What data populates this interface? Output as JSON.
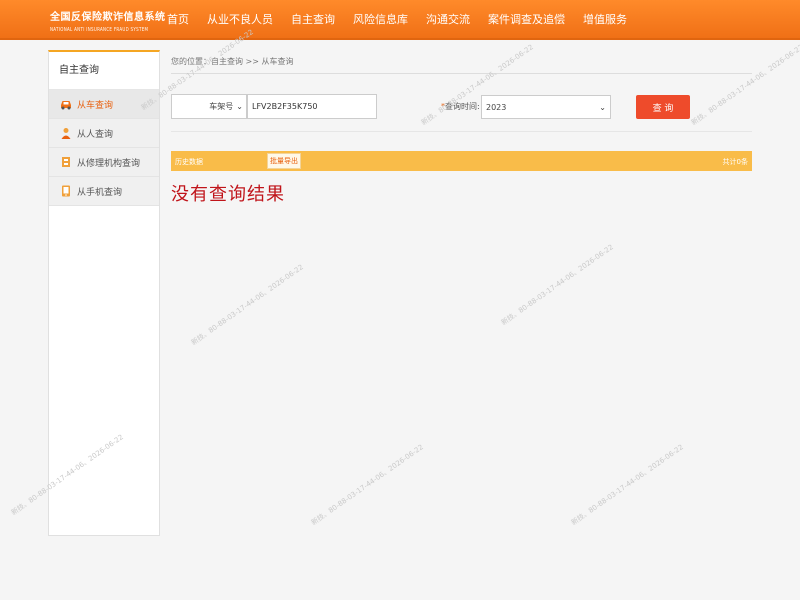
{
  "header": {
    "logo_cn": "全国反保险欺诈信息系统",
    "logo_en": "NATIONAL ANTI INSURANCE FRAUD SYSTEM",
    "nav": [
      {
        "label": "首页"
      },
      {
        "label": "从业不良人员"
      },
      {
        "label": "自主查询"
      },
      {
        "label": "风险信息库"
      },
      {
        "label": "沟通交流"
      },
      {
        "label": "案件调查及追偿"
      },
      {
        "label": "增值服务"
      }
    ]
  },
  "sidebar": {
    "title": "自主查询",
    "items": [
      {
        "label": "从车查询",
        "icon": "car-icon"
      },
      {
        "label": "从人查询",
        "icon": "person-icon"
      },
      {
        "label": "从修理机构查询",
        "icon": "repair-shop-icon"
      },
      {
        "label": "从手机查询",
        "icon": "phone-icon"
      }
    ]
  },
  "breadcrumb": "您的位置：自主查询 >> 从车查询",
  "search": {
    "field_type": "车架号",
    "vin_value": "LFV2B2F35K750",
    "time_label": "查询时间:",
    "year": "2023",
    "button": "查 询"
  },
  "results": {
    "history_label": "历史数据",
    "export_label": "批量导出",
    "total_label": "共计0条",
    "no_result": "没有查询结果"
  },
  "watermark": "新技、80-88-03-17-44-06、2026-06-22",
  "colors": {
    "brand_orange": "#f07016",
    "result_bar": "#f9bc49",
    "search_button": "#ee4b2b",
    "no_result_text": "#c0141a"
  }
}
